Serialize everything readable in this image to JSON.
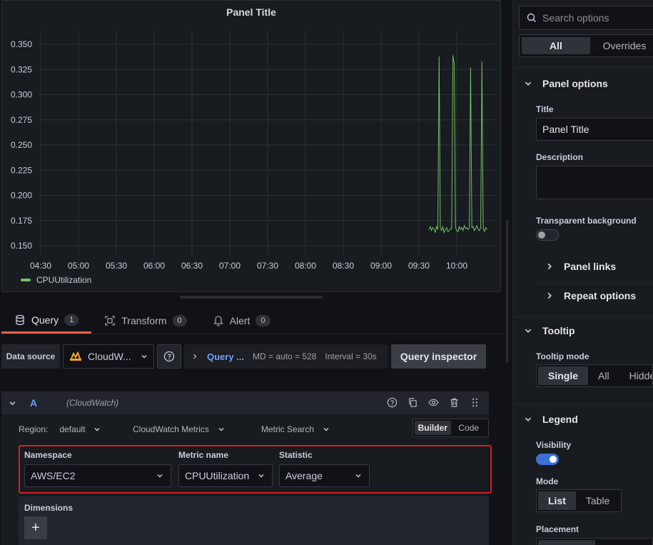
{
  "panel": {
    "title": "Panel Title",
    "legend_label": "CPUUtilization"
  },
  "chart_data": {
    "type": "line",
    "title": "Panel Title",
    "y_ticks": [
      "0.350",
      "0.325",
      "0.300",
      "0.275",
      "0.250",
      "0.225",
      "0.200",
      "0.175",
      "0.150"
    ],
    "x_ticks": [
      "04:30",
      "05:00",
      "05:30",
      "06:00",
      "06:30",
      "07:00",
      "07:30",
      "08:00",
      "08:30",
      "09:00",
      "09:30",
      "10:00"
    ],
    "ylim": [
      0.15,
      0.35
    ],
    "series": [
      {
        "name": "CPUUtilization",
        "color": "#73bf69",
        "x": [
          "09:38",
          "09:39",
          "09:40",
          "09:41",
          "09:42",
          "09:43",
          "09:44",
          "09:45",
          "09:46",
          "09:47",
          "09:48",
          "09:49",
          "09:50",
          "09:51",
          "09:52",
          "09:53",
          "09:54",
          "09:55",
          "09:56",
          "09:57",
          "09:58",
          "09:59",
          "10:00",
          "10:01",
          "10:02",
          "10:03",
          "10:04",
          "10:05",
          "10:06",
          "10:07",
          "10:08",
          "10:09",
          "10:10",
          "10:11",
          "10:12",
          "10:13",
          "10:14",
          "10:15",
          "10:16",
          "10:17",
          "10:18",
          "10:19",
          "10:20",
          "10:21",
          "10:22",
          "10:23",
          "10:24"
        ],
        "y": [
          0.166,
          0.169,
          0.165,
          0.168,
          0.167,
          0.163,
          0.169,
          0.166,
          0.338,
          0.168,
          0.165,
          0.169,
          0.163,
          0.166,
          0.168,
          0.164,
          0.165,
          0.167,
          0.167,
          0.339,
          0.33,
          0.168,
          0.165,
          0.164,
          0.169,
          0.166,
          0.168,
          0.165,
          0.17,
          0.167,
          0.168,
          0.166,
          0.168,
          0.327,
          0.168,
          0.169,
          0.165,
          0.167,
          0.17,
          0.166,
          0.165,
          0.168,
          0.333,
          0.167,
          0.164,
          0.168,
          0.166
        ]
      }
    ],
    "grid": true,
    "legend": "bottom-left"
  },
  "tabs": [
    {
      "label": "Query",
      "count": "1",
      "icon": "database-icon"
    },
    {
      "label": "Transform",
      "count": "0",
      "icon": "transform-icon"
    },
    {
      "label": "Alert",
      "count": "0",
      "icon": "bell-icon"
    }
  ],
  "datasource": {
    "label": "Data source",
    "selected": "CloudW...",
    "query_options_label": "Query ...",
    "md": "MD = auto = 528",
    "interval": "Interval = 30s",
    "inspector_button": "Query inspector"
  },
  "query": {
    "ref_id": "A",
    "ds_name": "(CloudWatch)",
    "region_label": "Region:",
    "region_value": "default",
    "service": "CloudWatch Metrics",
    "mode": "Metric Search",
    "editor_modes": [
      "Builder",
      "Code"
    ],
    "active_editor_mode": "Builder",
    "namespace_label": "Namespace",
    "namespace_value": "AWS/EC2",
    "metric_label": "Metric name",
    "metric_value": "CPUUtilization",
    "statistic_label": "Statistic",
    "statistic_value": "Average",
    "dimensions_label": "Dimensions",
    "add_symbol": "+"
  },
  "options": {
    "search_placeholder": "Search options",
    "tab_all": "All",
    "tab_overrides": "Overrides",
    "panel_options": "Panel options",
    "title_label": "Title",
    "title_value": "Panel Title",
    "description_label": "Description",
    "transparent_label": "Transparent background",
    "panel_links": "Panel links",
    "repeat_options": "Repeat options",
    "tooltip": "Tooltip",
    "tooltip_mode_label": "Tooltip mode",
    "tooltip_modes": [
      "Single",
      "All",
      "Hidden"
    ],
    "legend": "Legend",
    "visibility_label": "Visibility",
    "mode_label": "Mode",
    "legend_modes": [
      "List",
      "Table"
    ],
    "placement_label": "Placement"
  }
}
